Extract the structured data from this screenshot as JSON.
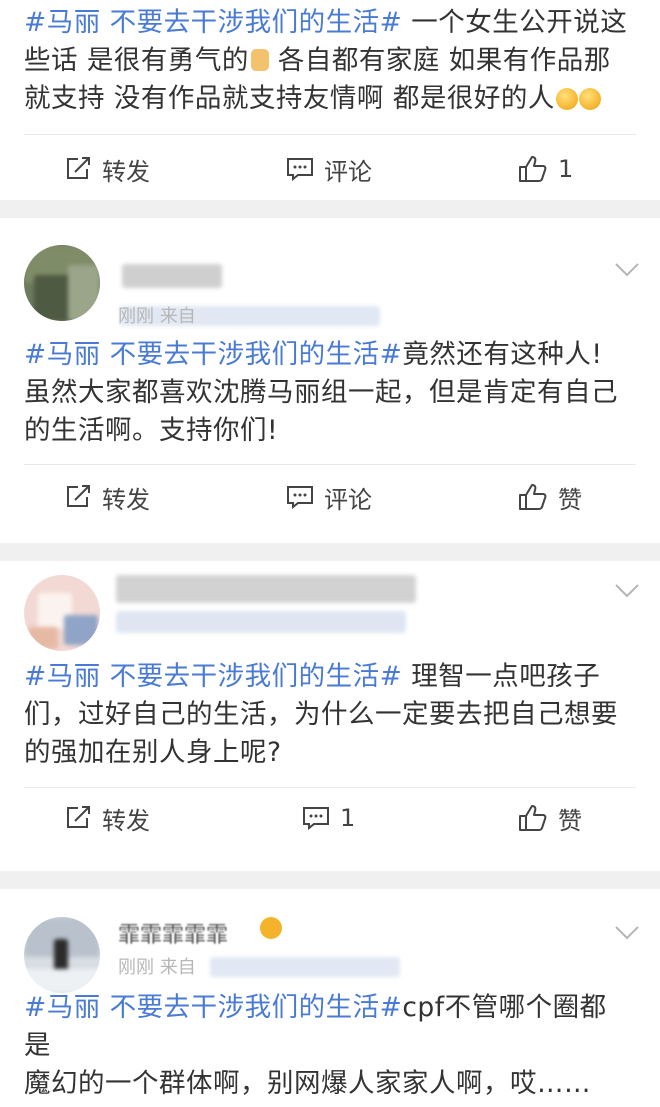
{
  "posts": [
    {
      "hashtag": "#马丽 不要去干涉我们的生活#",
      "line1_text": " 一个女生公开说这",
      "line2_text": "些话 是很有勇气的",
      "line2_text_b": " 各自都有家庭 如果有作品那",
      "line3_text": "就支持 没有作品就支持友情啊 都是很好的人",
      "repost_label": "转发",
      "comment_label": "评论",
      "like_label": "1"
    },
    {
      "hashtag": "#马丽 不要去干涉我们的生活#",
      "line1_text": "竟然还有这种人!",
      "line2": "虽然大家都喜欢沈腾马丽组一起，但是肯定有自己",
      "line3": "的生活啊。支持你们!",
      "meta_visible": "刚刚  来自",
      "repost_label": "转发",
      "comment_label": "评论",
      "like_label": "赞"
    },
    {
      "hashtag": "#马丽 不要去干涉我们的生活#",
      "line1_text": " 理智一点吧孩子",
      "line2": "们，过好自己的生活，为什么一定要去把自己想要",
      "line3": "的强加在别人身上呢?",
      "repost_label": "转发",
      "comment_label": "1",
      "like_label": "赞"
    },
    {
      "username": "霏霏霏霏霏",
      "meta_visible": "刚刚  来自",
      "hashtag": "#马丽 不要去干涉我们的生活#",
      "line1_text": "cpf不管哪个圈都是",
      "line2": "魔幻的一个群体啊，别网爆人家家人啊，哎……"
    }
  ],
  "colors": {
    "hashtag": "#4a7bd4",
    "text": "#333333",
    "separator": "#f0f0f0",
    "icon": "#444444"
  },
  "icons": [
    "repost-icon",
    "comment-icon",
    "like-icon",
    "chevron-down-icon"
  ]
}
